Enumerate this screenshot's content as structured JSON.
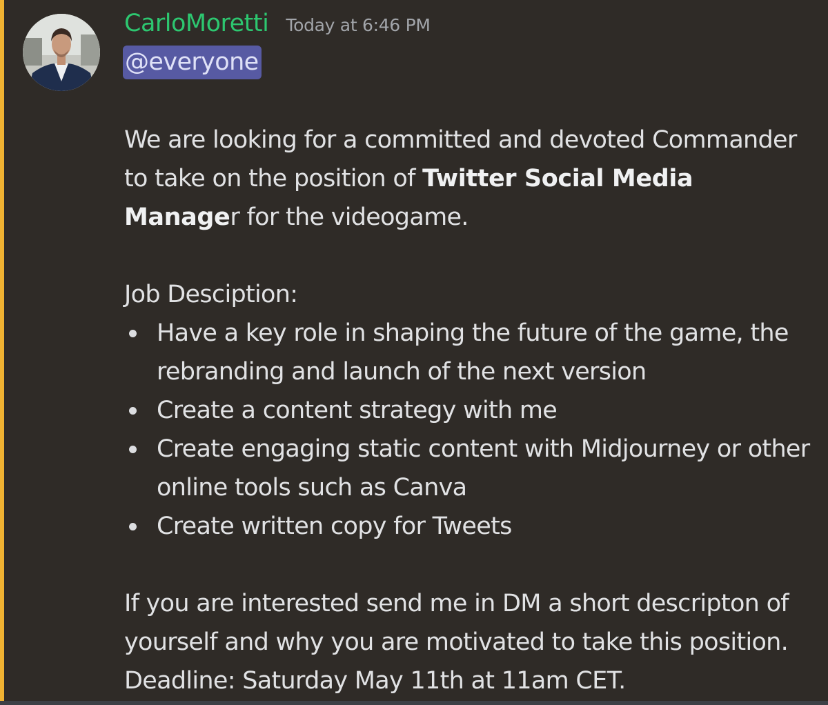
{
  "author": {
    "name": "CarloMoretti",
    "timestamp": "Today at 6:46 PM",
    "name_color": "#2dc770"
  },
  "mention": "@everyone",
  "body": {
    "intro_part1": "We are looking for a committed and devoted Commander to take on the position of ",
    "intro_bold": "Twitter Social Media Manage",
    "intro_part2": "r for the videogame.",
    "job_heading": "Job Desciption:",
    "bullets": [
      "Have a key role in shaping the future of the game, the rebranding and launch of the next version",
      "Create a content strategy with me",
      "Create engaging static content with Midjourney or other online tools such as Canva",
      "Create written copy for Tweets"
    ],
    "closing": "If you are interested send me in DM a short descripton of yourself and why you are motivated to take this position. Deadline: Saturday May 11th at 11am CET."
  },
  "colors": {
    "background": "#2f2b27",
    "highlight_bar": "#f0b232",
    "mention_bg": "#575aa3",
    "text": "#e1e2e4",
    "timestamp": "#a2a5aa"
  },
  "icons": {
    "avatar": "user-avatar-photo"
  }
}
